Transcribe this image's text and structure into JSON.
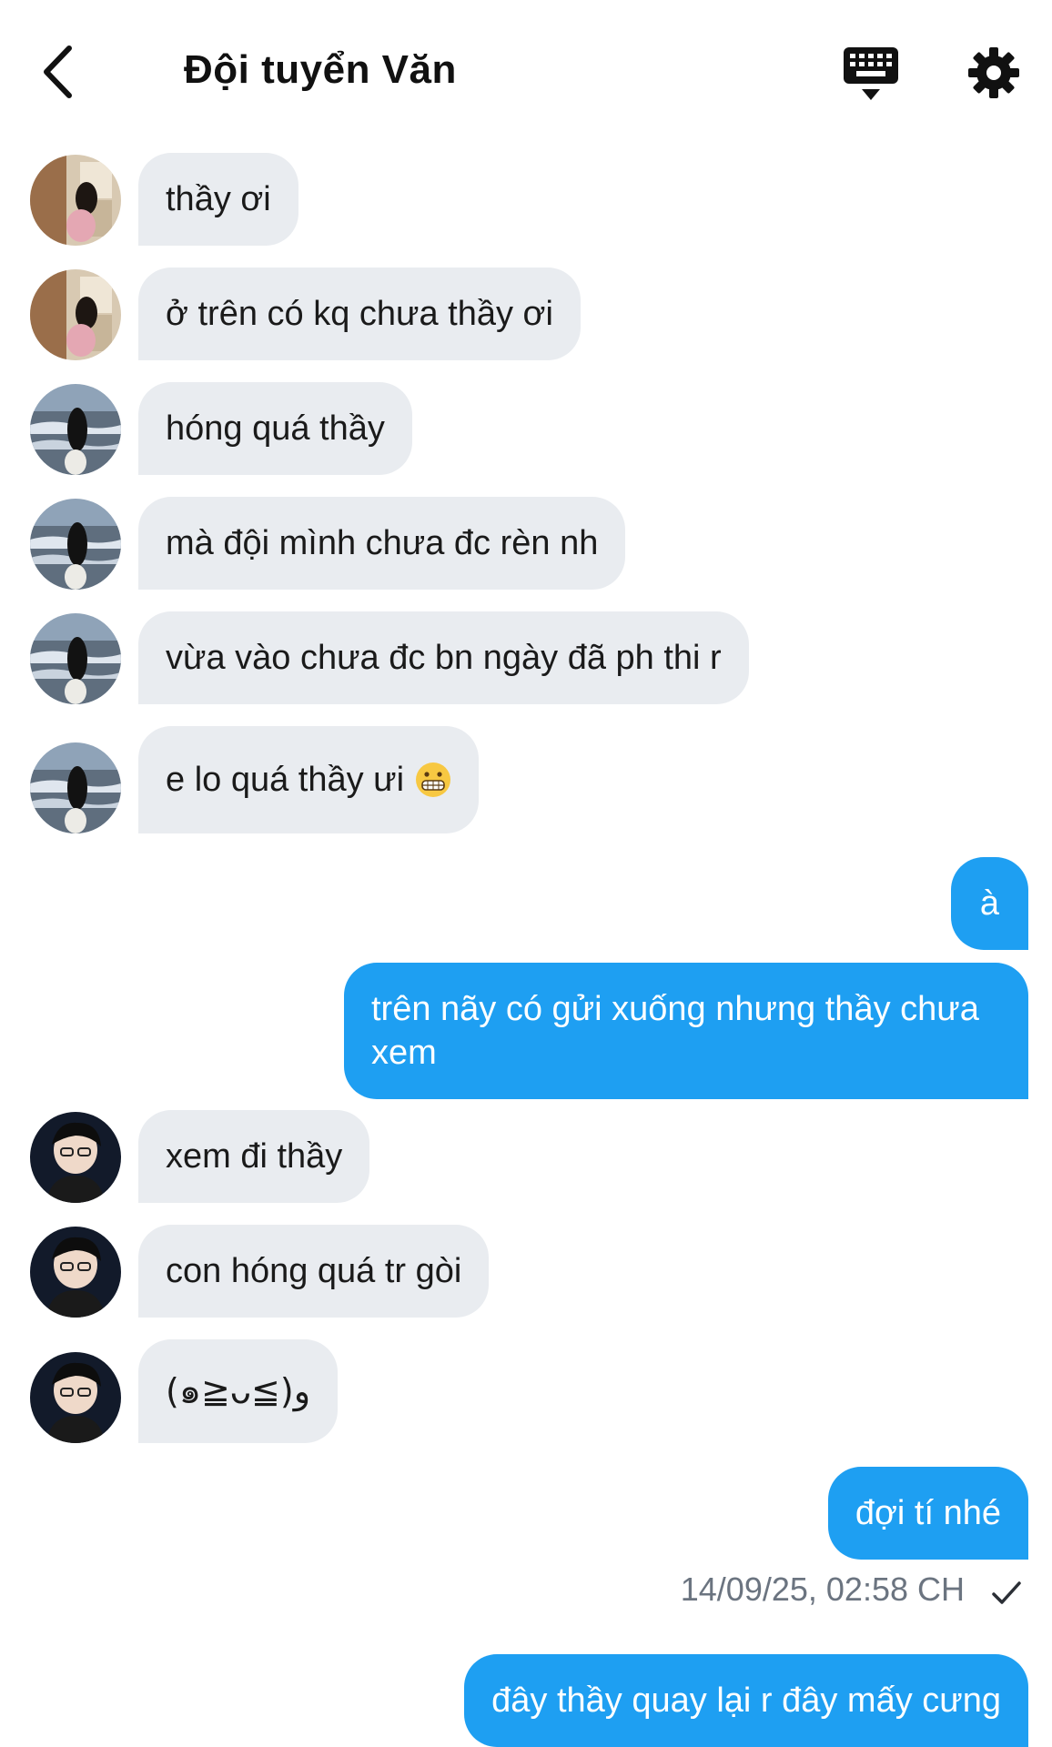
{
  "header": {
    "title": "Đội tuyển Văn",
    "back_icon": "chevron-left-icon",
    "keyboard_icon": "keyboard-icon",
    "settings_icon": "gear-icon"
  },
  "colors": {
    "incoming_bubble": "#e9ecf0",
    "outgoing_bubble": "#1e9ff2",
    "timestamp": "#6b7480"
  },
  "messages": [
    {
      "direction": "in",
      "sender": "avatar-a",
      "text": "thầy ơi"
    },
    {
      "direction": "in",
      "sender": "avatar-a",
      "text": "ở trên có kq chưa thầy ơi"
    },
    {
      "direction": "in",
      "sender": "avatar-b",
      "text": "hóng quá thầy"
    },
    {
      "direction": "in",
      "sender": "avatar-b",
      "text": "mà đội mình chưa đc rèn nh"
    },
    {
      "direction": "in",
      "sender": "avatar-b",
      "text": "vừa vào chưa đc bn ngày đã ph thi r"
    },
    {
      "direction": "in",
      "sender": "avatar-b",
      "text": "e lo quá thầy ưi",
      "emoji": "grimacing-face-emoji"
    },
    {
      "direction": "out",
      "text": "à"
    },
    {
      "direction": "out",
      "text": "trên nãy có gửi xuống nhưng thầy chưa xem"
    },
    {
      "direction": "in",
      "sender": "avatar-c",
      "text": "xem đi thầy"
    },
    {
      "direction": "in",
      "sender": "avatar-c",
      "text": "con hóng quá tr gòi"
    },
    {
      "direction": "in",
      "sender": "avatar-c",
      "text": "(๑≧ᴗ≦)و"
    },
    {
      "direction": "out",
      "text": "đợi tí nhé"
    },
    {
      "direction": "out",
      "text": "đây thầy quay lại r đây mấy cưng"
    }
  ],
  "status": {
    "timestamp": "14/09/25, 02:58 CH",
    "check_icon": "checkmark-icon"
  }
}
